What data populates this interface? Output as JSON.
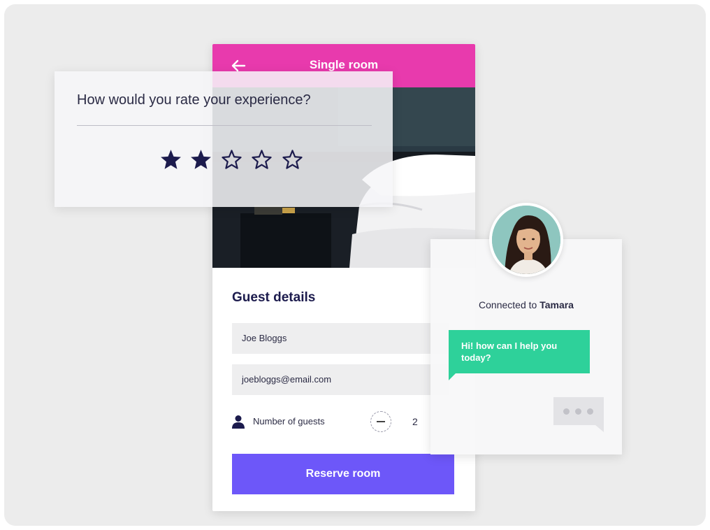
{
  "phone": {
    "title": "Single room",
    "back_icon": "arrow-left-icon",
    "header_color": "#e83aad",
    "photo": "hotel-room-photo"
  },
  "guest_details": {
    "heading": "Guest details",
    "name_value": "Joe Bloggs",
    "email_value": "joebloggs@email.com",
    "guests_label": "Number of guests",
    "guests_count": "2",
    "person_icon": "person-icon",
    "minus_icon": "minus-icon"
  },
  "reserve": {
    "label": "Reserve room",
    "color": "#6d57f9"
  },
  "rating": {
    "question": "How would you rate your experience?",
    "filled_stars": 2,
    "total_stars": 5,
    "star_color": "#1c1b4d"
  },
  "chat": {
    "connected_prefix": "Connected to",
    "agent_name": "Tamara",
    "message": "Hi! how can I help you today?",
    "bubble_color": "#2ed19a",
    "typing_icon": "typing-indicator-icon"
  }
}
